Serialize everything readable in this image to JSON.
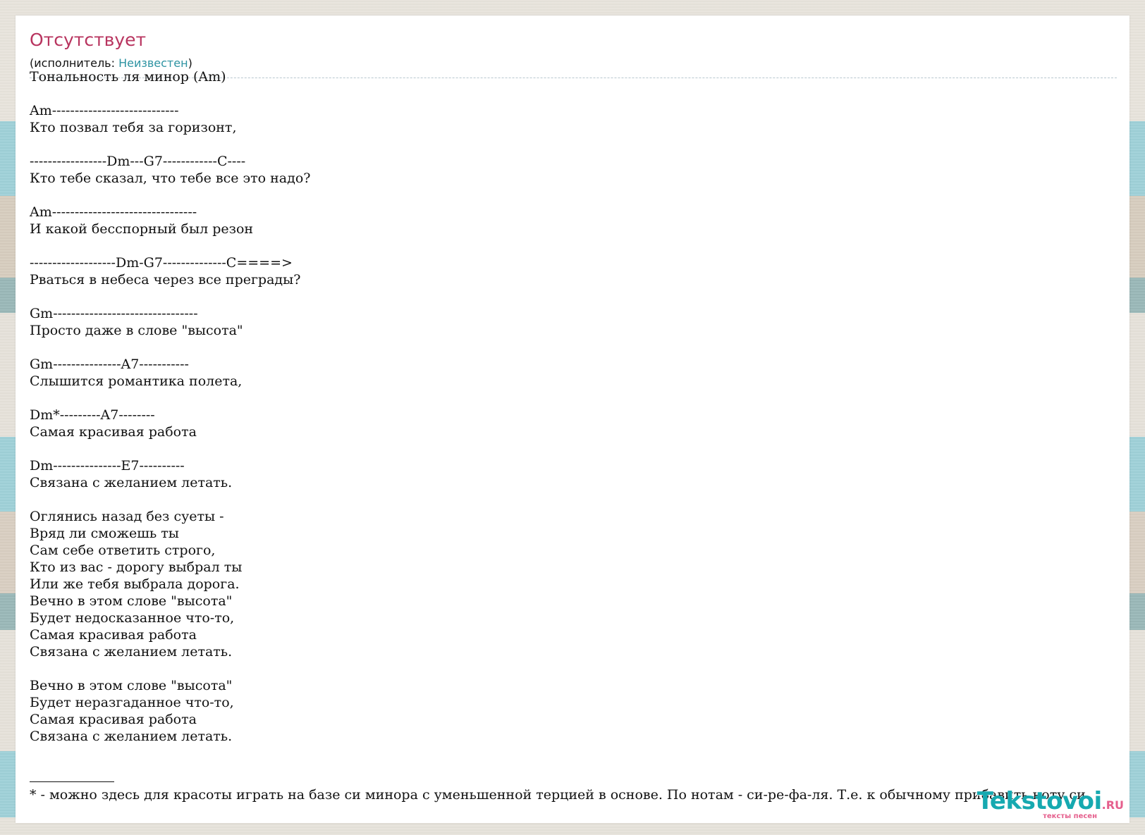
{
  "song": {
    "title": "Отсутствует",
    "artist_prefix": "(исполнитель: ",
    "artist_name": "Неизвестен",
    "artist_suffix": ")"
  },
  "lyrics": {
    "text": "Тональность ля минор (Am)\n\nAm----------------------------\nКто позвал тебя за горизонт,\n\n-----------------Dm---G7------------C----\nКто тебе сказал, что тебе все это надо?\n\nAm--------------------------------\nИ какой бесспорный был резон\n\n-------------------Dm-G7--------------C====>\nРваться в небеса через все преграды?\n\nGm--------------------------------\nПросто даже в слове \"высота\"\n\nGm---------------A7-----------\nСлышится романтика полета,\n\nDm*---------A7--------\nСамая красивая работа\n\nDm---------------E7----------\nСвязана с желанием летать.\n\nОглянись назад без суеты -\nВряд ли сможешь ты\nСам себе ответить строго,\nКто из вас - дорогу выбрал ты\nИли же тебя выбрала дорога.\nВечно в этом слове \"высота\"\nБудет недосказанное что-то,\nСамая красивая работа\nСвязана с желанием летать.\n\nВечно в этом слове \"высота\"\nБудет неразгаданное что-то,\nСамая красивая работа\nСвязана с желанием летать."
  },
  "footnote": {
    "text": "* - можно здесь для красоты играть на базе си минора с уменьшенной терцией в основе. По нотам - си-ре-фа-ля. Т.е. к обычному прибавить ноту си."
  },
  "logo": {
    "main": "Tekstovoi",
    "domain": ".RU",
    "tagline": "тексты песен"
  }
}
